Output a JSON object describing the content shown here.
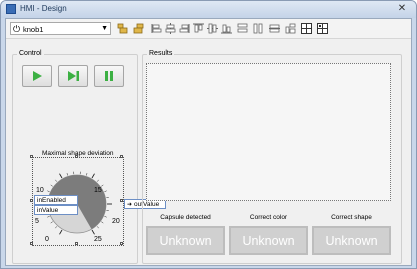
{
  "window": {
    "title": "HMI - Design",
    "close_glyph": "✕"
  },
  "toolbar": {
    "selector": {
      "value": "knob1",
      "icon": "power-icon"
    },
    "icons": [
      "align-left-icon",
      "align-right-icon",
      "align-top-icon",
      "align-center-icon",
      "align-middle-icon",
      "align-bottom-icon",
      "same-width-icon",
      "same-height-icon",
      "same-size-icon",
      "distribute-horizontal-icon",
      "distribute-vertical-icon",
      "grid-icon",
      "snap-grid-icon"
    ]
  },
  "control": {
    "label": "Control",
    "buttons": [
      "play",
      "step",
      "pause"
    ],
    "accent": "#3cb043"
  },
  "knob": {
    "title": "Maximal shape deviation",
    "scale": [
      "0",
      "5",
      "10",
      "15",
      "20",
      "25"
    ],
    "value": 6,
    "pins_in": [
      "inEnabled",
      "inValue"
    ],
    "pin_out": "outValue"
  },
  "results": {
    "label": "Results",
    "statuses": [
      {
        "label": "Capsule detected",
        "value": "Unknown"
      },
      {
        "label": "Correct color",
        "value": "Unknown"
      },
      {
        "label": "Correct shape",
        "value": "Unknown"
      }
    ]
  }
}
